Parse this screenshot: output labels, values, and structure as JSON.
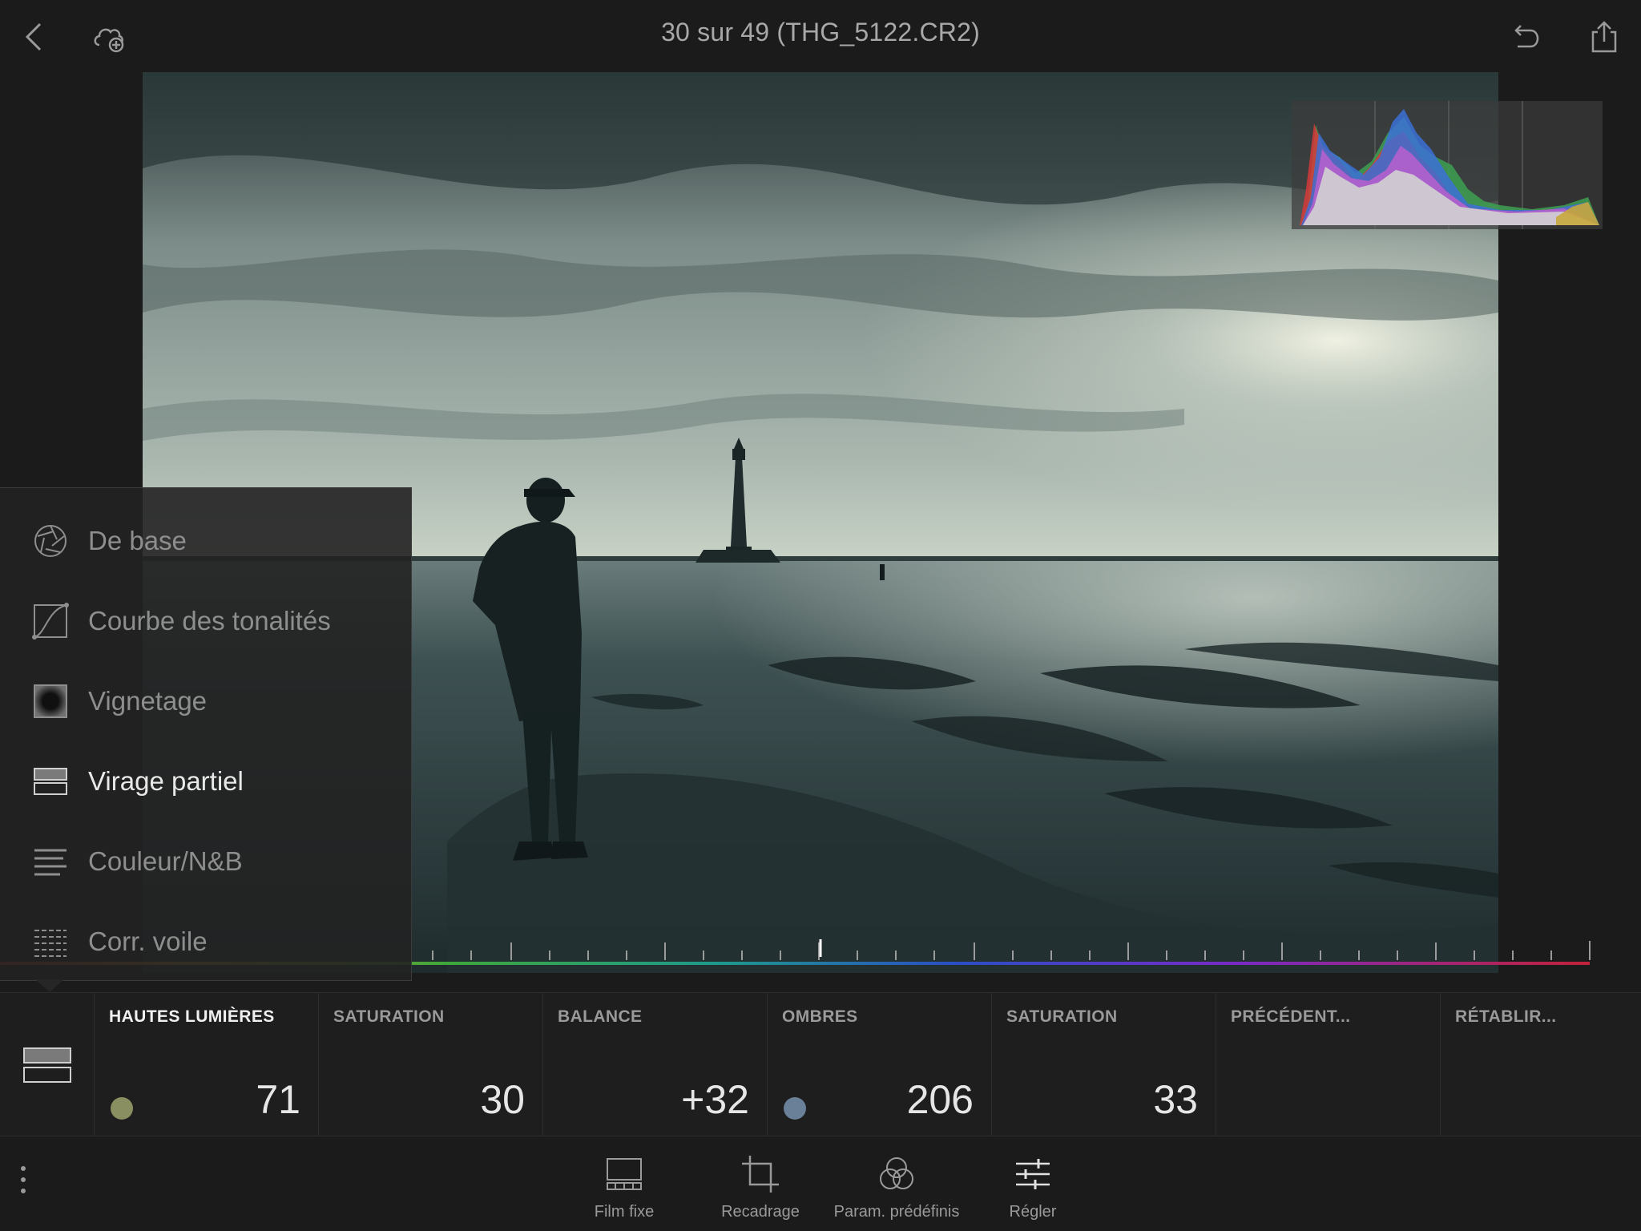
{
  "header": {
    "title": "30 sur 49 (THG_5122.CR2)"
  },
  "side_menu": {
    "items": [
      {
        "label": "De base",
        "icon": "aperture-icon"
      },
      {
        "label": "Courbe des tonalités",
        "icon": "tone-curve-icon"
      },
      {
        "label": "Vignetage",
        "icon": "vignette-icon"
      },
      {
        "label": "Virage partiel",
        "icon": "split-toning-icon",
        "active": true
      },
      {
        "label": "Couleur/N&B",
        "icon": "color-bw-icon"
      },
      {
        "label": "Corr. voile",
        "icon": "dehaze-icon"
      }
    ]
  },
  "params": {
    "items": [
      {
        "label": "HAUTES LUMIÈRES",
        "value": "71",
        "swatch": "#8a8f62",
        "active": true
      },
      {
        "label": "SATURATION",
        "value": "30"
      },
      {
        "label": "BALANCE",
        "value": "+32"
      },
      {
        "label": "OMBRES",
        "value": "206",
        "swatch": "#6a7f98"
      },
      {
        "label": "SATURATION",
        "value": "33"
      },
      {
        "label": "PRÉCÉDENT...",
        "value": ""
      },
      {
        "label": "RÉTABLIR...",
        "value": ""
      }
    ]
  },
  "toolbar": {
    "items": [
      {
        "label": "Film fixe",
        "icon": "filmstrip-icon"
      },
      {
        "label": "Recadrage",
        "icon": "crop-icon"
      },
      {
        "label": "Param. prédéfinis",
        "icon": "presets-icon"
      },
      {
        "label": "Régler",
        "icon": "adjust-sliders-icon"
      }
    ]
  },
  "colors": {
    "background": "#1b1b1b",
    "panel": "#1e1e1e",
    "highlight_swatch": "#8a8f62",
    "shadow_swatch": "#6a7f98"
  }
}
